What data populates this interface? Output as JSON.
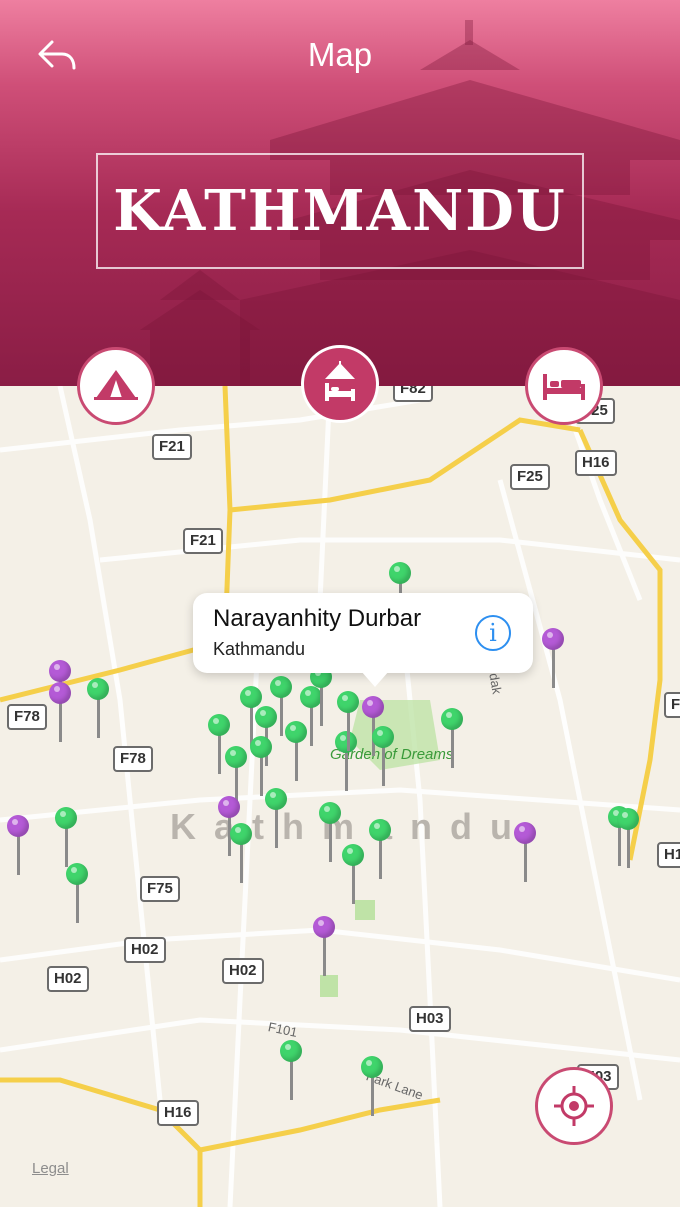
{
  "header": {
    "title": "Map",
    "city": "KATHMANDU"
  },
  "categories": [
    {
      "name": "tent",
      "active": false
    },
    {
      "name": "camp-hotel",
      "active": true
    },
    {
      "name": "bed",
      "active": false
    }
  ],
  "map": {
    "city_label": "Kathmandu",
    "park_label": "Garden of Dreams",
    "street_label": "Park Lane",
    "road_f101": "F101",
    "road_dak": "dak",
    "road_labels": [
      "F21",
      "F21",
      "F25",
      "H16",
      "F78",
      "F78",
      "F75",
      "H02",
      "H02",
      "H02",
      "H03",
      "H16",
      "F82",
      "F25",
      "H1",
      "F",
      "H03"
    ],
    "legal": "Legal"
  },
  "callout": {
    "title": "Narayanhity Durbar",
    "subtitle": "Kathmandu",
    "info_glyph": "i"
  },
  "colors": {
    "accent": "#c23a67",
    "pin_green": "#3fd46b",
    "pin_purple": "#b45ad6",
    "road_major": "#f5cf4a"
  }
}
